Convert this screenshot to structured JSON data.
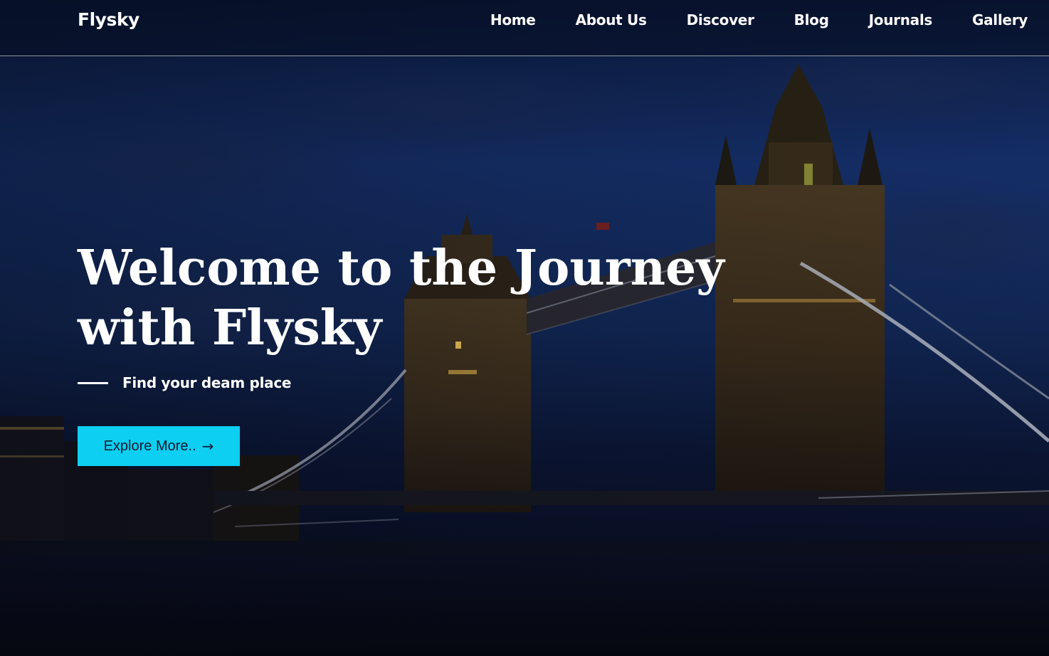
{
  "brand": {
    "name": "Flysky"
  },
  "nav": {
    "items": [
      {
        "label": "Home"
      },
      {
        "label": "About Us"
      },
      {
        "label": "Discover"
      },
      {
        "label": "Blog"
      },
      {
        "label": "Journals"
      },
      {
        "label": "Gallery"
      }
    ]
  },
  "hero": {
    "title": "Welcome to the Journey with Flysky",
    "tagline": "Find your deam place",
    "cta_label": "Explore More..",
    "cta_icon": "arrow-right-icon",
    "background_image": "tower-bridge-night-photo"
  },
  "colors": {
    "accent": "#0dcff2",
    "text": "#ffffff",
    "sky": "#132a5c"
  }
}
